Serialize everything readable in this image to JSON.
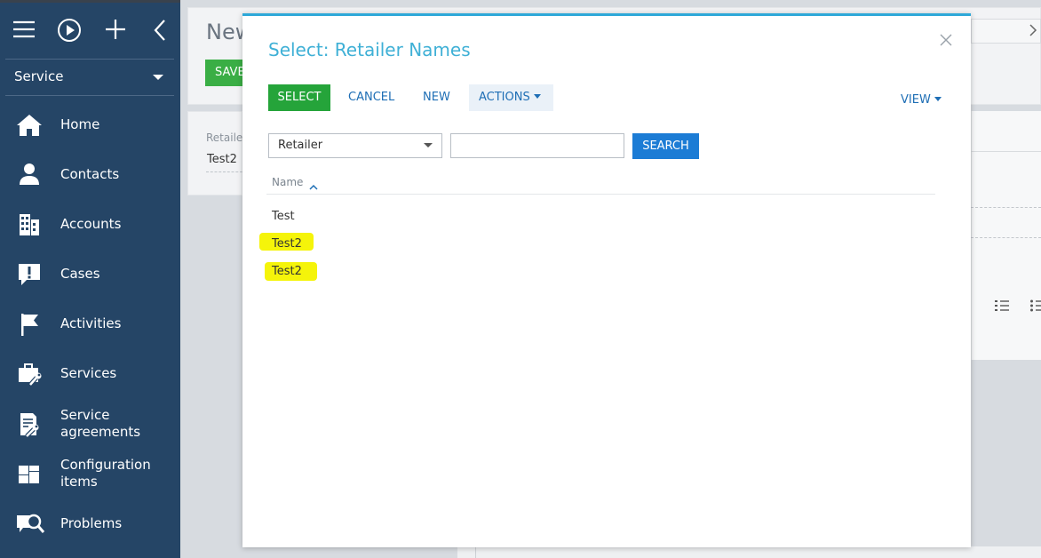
{
  "sidebar": {
    "section": "Service",
    "items": [
      {
        "label": "Home",
        "icon": "home-icon"
      },
      {
        "label": "Contacts",
        "icon": "person-icon"
      },
      {
        "label": "Accounts",
        "icon": "building-icon"
      },
      {
        "label": "Cases",
        "icon": "exclamation-bubble-icon"
      },
      {
        "label": "Activities",
        "icon": "flag-icon"
      },
      {
        "label": "Services",
        "icon": "briefcase-wrench-icon"
      },
      {
        "label": "Service\nagreements",
        "icon": "document-wrench-icon"
      },
      {
        "label": "Configuration\nitems",
        "icon": "blocks-icon"
      },
      {
        "label": "Problems",
        "icon": "magnifier-bubble-icon"
      }
    ]
  },
  "background_page": {
    "title": "New",
    "save_label": "SAVE",
    "field_label": "Retailer",
    "field_value": "Test2"
  },
  "modal": {
    "title": "Select: Retailer Names",
    "select_label": "SELECT",
    "cancel_label": "CANCEL",
    "new_label": "NEW",
    "actions_label": "ACTIONS",
    "view_label": "VIEW",
    "filter_field": "Retailer",
    "search_value": "",
    "search_label": "SEARCH",
    "column_header": "Name",
    "rows": [
      "Test",
      "Test2",
      "Test2"
    ]
  },
  "colors": {
    "sidebar_bg": "#254566",
    "modal_accent": "#2da8d8",
    "select_green": "#25a43a",
    "search_blue": "#1c7cd5",
    "link_blue": "#1e6eb5",
    "highlight_yellow": "#f5f40a"
  }
}
